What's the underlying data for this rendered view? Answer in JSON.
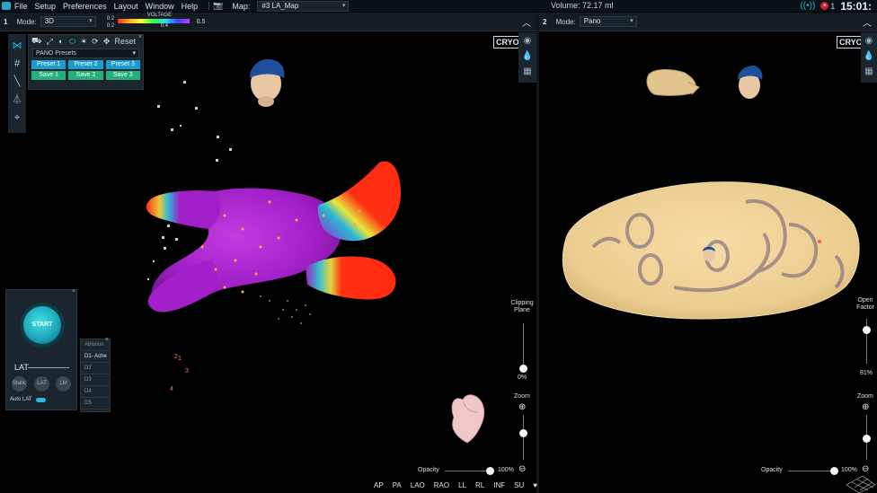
{
  "menubar": {
    "items": [
      "File",
      "Setup",
      "Preferences",
      "Layout",
      "Window",
      "Help"
    ],
    "map_label": "Map:",
    "map_value": "#3 LA_Map",
    "volume": "Volume: 72.17 ml",
    "alert_count": "1",
    "clock": "15:01:"
  },
  "viewport1": {
    "number": "1",
    "mode_label": "Mode:",
    "mode_value": "3D",
    "voltage_label": "VOLTAGE",
    "voltage_min_top": "0.2",
    "voltage_max_top": "0.5",
    "voltage_low": "0.2",
    "voltage_high": "0.4",
    "cryo_label": "CRYO",
    "clipping_label": "Clipping Plane",
    "clipping_value": "0%",
    "zoom_label": "Zoom",
    "opacity_label": "Opacity",
    "opacity_value": "100%",
    "views": [
      "AP",
      "PA",
      "LAO",
      "RAO",
      "LL",
      "RL",
      "INF",
      "SU",
      "♥"
    ]
  },
  "viewport2": {
    "number": "2",
    "mode_label": "Mode:",
    "mode_value": "Pano",
    "cryo_label": "CRYO",
    "open_factor_label": "Open Factor",
    "open_factor_value": "81%",
    "zoom_label": "Zoom",
    "opacity_label": "Opacity",
    "opacity_value": "100%"
  },
  "pano_panel": {
    "reset": "Reset",
    "presets_select": "PANO Presets",
    "presets": [
      "Preset 1",
      "Preset 2",
      "Preset 3"
    ],
    "saves": [
      "Save 1",
      "Save 2",
      "Save 3"
    ]
  },
  "stage_panel": {
    "start": "START",
    "lat": "LAT",
    "modes": [
      "Static",
      "LAT",
      "LM"
    ],
    "auto_lat": "Auto LAT"
  },
  "ablation_panel": {
    "header": "Ablation",
    "items": [
      "D1- Ache",
      "D2",
      "D3",
      "D4",
      "D5"
    ]
  },
  "annotations": [
    "2",
    "1",
    "3",
    "4"
  ],
  "colors": {
    "accent": "#2fb8e6",
    "preset": "#1b9ccf",
    "save": "#23b07a",
    "map_purple": "#a21fc9",
    "map_red": "#ff2b12",
    "pano_tan": "#f2d49b"
  }
}
